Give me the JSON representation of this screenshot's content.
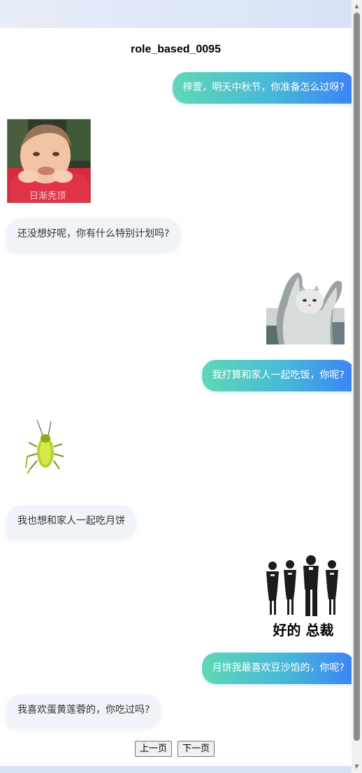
{
  "conversation": {
    "title": "role_based_0095"
  },
  "messages": [
    {
      "side": "right",
      "text": "梓萱，明天中秋节，你准备怎么过呀?"
    },
    {
      "side": "left",
      "sticker": "crying-baby-sticker",
      "caption": "日渐秃顶"
    },
    {
      "side": "left",
      "text": "还没想好呢，你有什么特别计划吗?"
    },
    {
      "side": "right",
      "sticker": "cat-raising-arms-sticker"
    },
    {
      "side": "right",
      "text": "我打算和家人一起吃饭，你呢?"
    },
    {
      "side": "left",
      "sticker": "dancing-cockroach-sticker"
    },
    {
      "side": "left",
      "text": "我也想和家人一起吃月饼"
    },
    {
      "side": "right",
      "sticker": "bowing-staff-sticker",
      "caption": "好的 总裁"
    },
    {
      "side": "right",
      "text": "月饼我最喜欢豆沙馅的，你呢?"
    },
    {
      "side": "left",
      "text": "我喜欢蛋黄莲蓉的，你吃过吗?"
    }
  ],
  "pagination": {
    "prev_label": "上一页",
    "next_label": "下一页"
  },
  "colors": {
    "bubble_right_start": "#5fd8b6",
    "bubble_right_end": "#3b82f6",
    "bubble_left": "#f0f3f8"
  }
}
